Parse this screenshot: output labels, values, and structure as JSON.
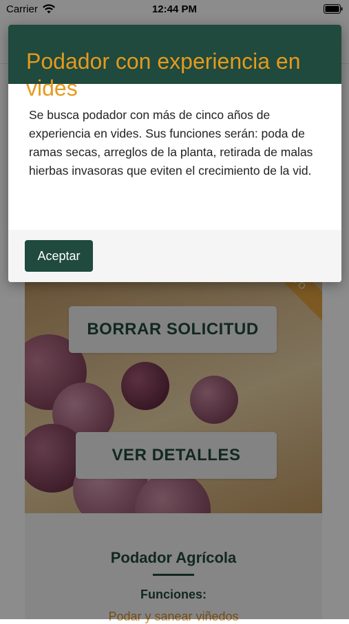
{
  "status_bar": {
    "carrier": "Carrier",
    "time": "12:44 PM"
  },
  "modal": {
    "title": "Podador con experiencia en vides",
    "description": "Se busca podador con más de cinco años de experiencia en vides. Sus funciones serán: poda de ramas secas, arreglos de la planta, retirada de malas hierbas invasoras que eviten el crecimiento de la vid.",
    "accept_label": "Aceptar"
  },
  "card": {
    "ribbon_label": "ABIERTO",
    "delete_label": "BORRAR SOLICITUD",
    "details_label": "VER DETALLES",
    "title": "Podador Agrícola",
    "functions_label": "Funciones:",
    "functions_value": "Podar y sanear viñedos"
  },
  "colors": {
    "primary": "#1f4a3d",
    "accent": "#e59a1d"
  }
}
